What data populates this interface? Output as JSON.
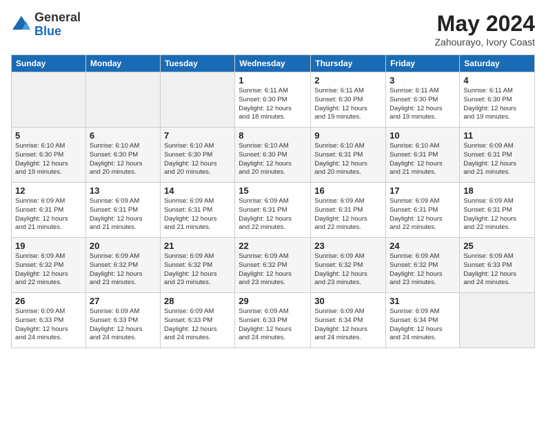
{
  "header": {
    "logo_general": "General",
    "logo_blue": "Blue",
    "month_year": "May 2024",
    "location": "Zahourayo, Ivory Coast"
  },
  "weekdays": [
    "Sunday",
    "Monday",
    "Tuesday",
    "Wednesday",
    "Thursday",
    "Friday",
    "Saturday"
  ],
  "weeks": [
    [
      {
        "day": "",
        "info": ""
      },
      {
        "day": "",
        "info": ""
      },
      {
        "day": "",
        "info": ""
      },
      {
        "day": "1",
        "info": "Sunrise: 6:11 AM\nSunset: 6:30 PM\nDaylight: 12 hours\nand 18 minutes."
      },
      {
        "day": "2",
        "info": "Sunrise: 6:11 AM\nSunset: 6:30 PM\nDaylight: 12 hours\nand 19 minutes."
      },
      {
        "day": "3",
        "info": "Sunrise: 6:11 AM\nSunset: 6:30 PM\nDaylight: 12 hours\nand 19 minutes."
      },
      {
        "day": "4",
        "info": "Sunrise: 6:11 AM\nSunset: 6:30 PM\nDaylight: 12 hours\nand 19 minutes."
      }
    ],
    [
      {
        "day": "5",
        "info": "Sunrise: 6:10 AM\nSunset: 6:30 PM\nDaylight: 12 hours\nand 19 minutes."
      },
      {
        "day": "6",
        "info": "Sunrise: 6:10 AM\nSunset: 6:30 PM\nDaylight: 12 hours\nand 20 minutes."
      },
      {
        "day": "7",
        "info": "Sunrise: 6:10 AM\nSunset: 6:30 PM\nDaylight: 12 hours\nand 20 minutes."
      },
      {
        "day": "8",
        "info": "Sunrise: 6:10 AM\nSunset: 6:30 PM\nDaylight: 12 hours\nand 20 minutes."
      },
      {
        "day": "9",
        "info": "Sunrise: 6:10 AM\nSunset: 6:31 PM\nDaylight: 12 hours\nand 20 minutes."
      },
      {
        "day": "10",
        "info": "Sunrise: 6:10 AM\nSunset: 6:31 PM\nDaylight: 12 hours\nand 21 minutes."
      },
      {
        "day": "11",
        "info": "Sunrise: 6:09 AM\nSunset: 6:31 PM\nDaylight: 12 hours\nand 21 minutes."
      }
    ],
    [
      {
        "day": "12",
        "info": "Sunrise: 6:09 AM\nSunset: 6:31 PM\nDaylight: 12 hours\nand 21 minutes."
      },
      {
        "day": "13",
        "info": "Sunrise: 6:09 AM\nSunset: 6:31 PM\nDaylight: 12 hours\nand 21 minutes."
      },
      {
        "day": "14",
        "info": "Sunrise: 6:09 AM\nSunset: 6:31 PM\nDaylight: 12 hours\nand 21 minutes."
      },
      {
        "day": "15",
        "info": "Sunrise: 6:09 AM\nSunset: 6:31 PM\nDaylight: 12 hours\nand 22 minutes."
      },
      {
        "day": "16",
        "info": "Sunrise: 6:09 AM\nSunset: 6:31 PM\nDaylight: 12 hours\nand 22 minutes."
      },
      {
        "day": "17",
        "info": "Sunrise: 6:09 AM\nSunset: 6:31 PM\nDaylight: 12 hours\nand 22 minutes."
      },
      {
        "day": "18",
        "info": "Sunrise: 6:09 AM\nSunset: 6:31 PM\nDaylight: 12 hours\nand 22 minutes."
      }
    ],
    [
      {
        "day": "19",
        "info": "Sunrise: 6:09 AM\nSunset: 6:32 PM\nDaylight: 12 hours\nand 22 minutes."
      },
      {
        "day": "20",
        "info": "Sunrise: 6:09 AM\nSunset: 6:32 PM\nDaylight: 12 hours\nand 23 minutes."
      },
      {
        "day": "21",
        "info": "Sunrise: 6:09 AM\nSunset: 6:32 PM\nDaylight: 12 hours\nand 23 minutes."
      },
      {
        "day": "22",
        "info": "Sunrise: 6:09 AM\nSunset: 6:32 PM\nDaylight: 12 hours\nand 23 minutes."
      },
      {
        "day": "23",
        "info": "Sunrise: 6:09 AM\nSunset: 6:32 PM\nDaylight: 12 hours\nand 23 minutes."
      },
      {
        "day": "24",
        "info": "Sunrise: 6:09 AM\nSunset: 6:32 PM\nDaylight: 12 hours\nand 23 minutes."
      },
      {
        "day": "25",
        "info": "Sunrise: 6:09 AM\nSunset: 6:33 PM\nDaylight: 12 hours\nand 24 minutes."
      }
    ],
    [
      {
        "day": "26",
        "info": "Sunrise: 6:09 AM\nSunset: 6:33 PM\nDaylight: 12 hours\nand 24 minutes."
      },
      {
        "day": "27",
        "info": "Sunrise: 6:09 AM\nSunset: 6:33 PM\nDaylight: 12 hours\nand 24 minutes."
      },
      {
        "day": "28",
        "info": "Sunrise: 6:09 AM\nSunset: 6:33 PM\nDaylight: 12 hours\nand 24 minutes."
      },
      {
        "day": "29",
        "info": "Sunrise: 6:09 AM\nSunset: 6:33 PM\nDaylight: 12 hours\nand 24 minutes."
      },
      {
        "day": "30",
        "info": "Sunrise: 6:09 AM\nSunset: 6:34 PM\nDaylight: 12 hours\nand 24 minutes."
      },
      {
        "day": "31",
        "info": "Sunrise: 6:09 AM\nSunset: 6:34 PM\nDaylight: 12 hours\nand 24 minutes."
      },
      {
        "day": "",
        "info": ""
      }
    ]
  ]
}
